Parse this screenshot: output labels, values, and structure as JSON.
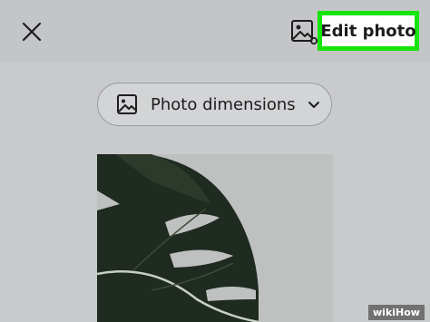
{
  "header": {
    "close_icon": "close-icon",
    "image_tool_icon": "image-sparkle-icon",
    "edit_photo_label": "Edit photo",
    "highlight_color": "#16e40a"
  },
  "dimensions_pill": {
    "icon": "image-icon",
    "label": "Photo dimensions",
    "chevron": "chevron-down-icon"
  },
  "photo": {
    "subject": "monstera-leaf"
  },
  "watermark": {
    "text": "wikiHow"
  }
}
